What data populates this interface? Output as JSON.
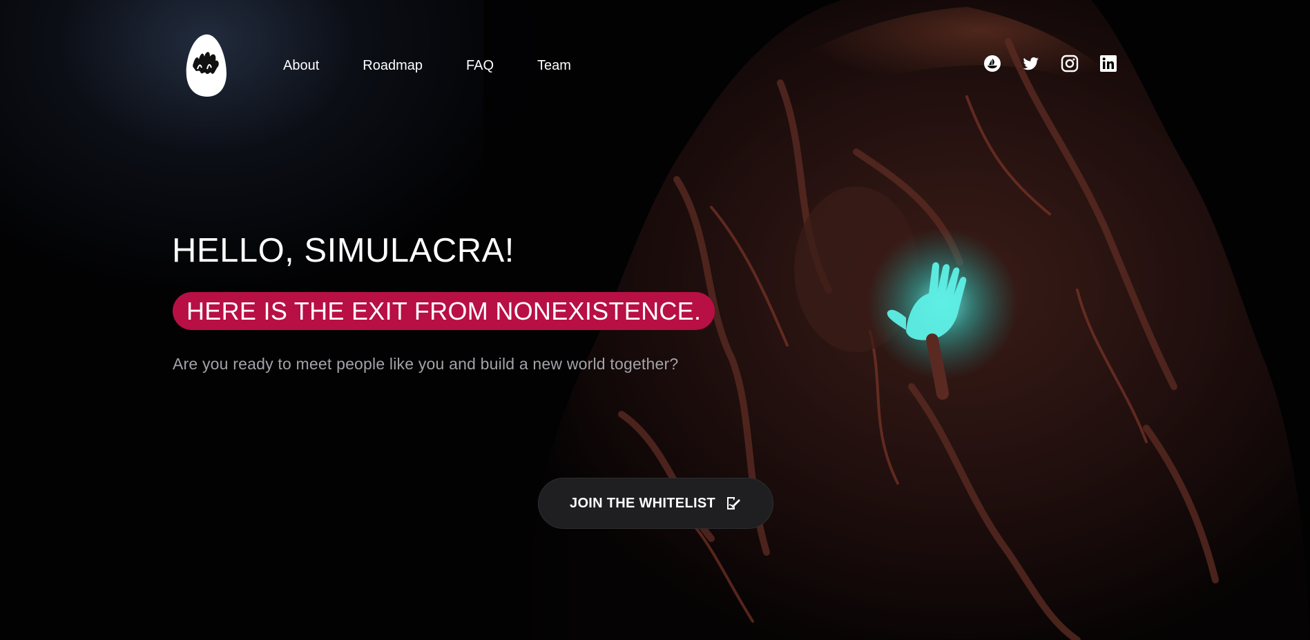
{
  "header": {
    "logo_icon": "simulacra-egg-logo-icon",
    "nav": [
      {
        "label": "About"
      },
      {
        "label": "Roadmap"
      },
      {
        "label": "FAQ"
      },
      {
        "label": "Team"
      }
    ],
    "social": [
      {
        "icon": "opensea-icon"
      },
      {
        "icon": "twitter-icon"
      },
      {
        "icon": "instagram-icon"
      },
      {
        "icon": "linkedin-icon"
      }
    ]
  },
  "hero": {
    "headline": "HELLO, SIMULACRA!",
    "tagline": "HERE IS THE EXIT FROM NONEXISTENCE.",
    "subtitle": "Are you ready to meet people like you and build a new world together?",
    "cta": {
      "label": "JOIN THE WHITELIST",
      "icon": "signature-edit-icon"
    },
    "artwork": "creature-with-glowing-hand-image"
  },
  "colors": {
    "background": "#020203",
    "tagline_bg": "#b80f45",
    "subtitle_text": "#a3a3a8",
    "cta_bg": "#1f1f21",
    "hand_glow": "#3fe0d6"
  }
}
